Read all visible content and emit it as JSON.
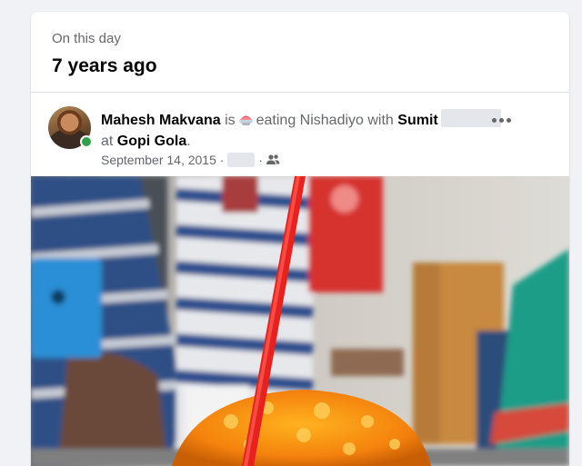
{
  "memory": {
    "eyebrow": "On this day",
    "headline": "7 years ago"
  },
  "post": {
    "author": "Mahesh Makvana",
    "is": "is",
    "activity": "eating Nishadiyo with",
    "tagged_friend": "Sumit",
    "at": "at",
    "place": "Gopi Gola",
    "period": ".",
    "date": "September 14, 2015",
    "separator": "·",
    "audience_icon": "friends-icon",
    "mood_icon": "shaved-ice-emoji",
    "more_icon": "more-dots-icon",
    "author_online": true
  },
  "photo": {
    "subject": "orange shaved ice with red straw"
  },
  "colors": {
    "page_bg": "#f0f2f5",
    "card_bg": "#ffffff",
    "primary_text": "#050505",
    "secondary_text": "#65676b",
    "online_green": "#31a24c"
  }
}
